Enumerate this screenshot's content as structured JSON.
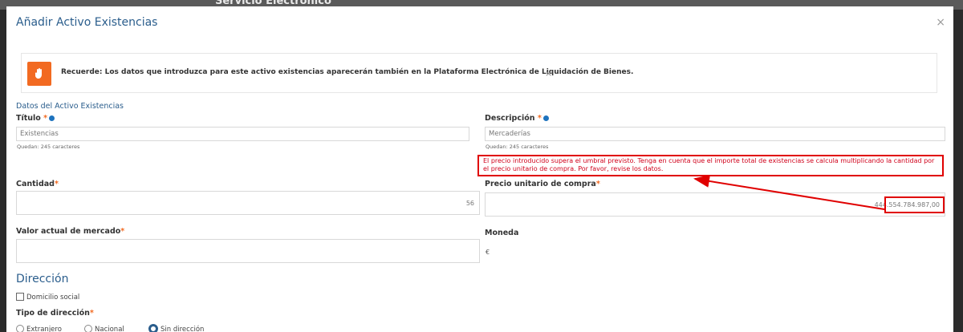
{
  "background": {
    "title": "Servicio Electrónico"
  },
  "modal": {
    "title": "Añadir Activo Existencias",
    "close_glyph": "×"
  },
  "notice": {
    "text": "Recuerde: Los datos que introduzca para este activo existencias aparecerán también en la Plataforma Electrónica de Liquidación de Bienes.",
    "dismiss_glyph": "×",
    "icon": "hand-icon",
    "accent": "#f26a21"
  },
  "section": {
    "label": "Datos del Activo Existencias"
  },
  "fields": {
    "titulo": {
      "label": "Título",
      "value": "Existencias",
      "hint": "Quedan: 245 caracteres"
    },
    "descripcion": {
      "label": "Descripción",
      "value": "Mercaderías",
      "hint": "Quedan: 245 caracteres"
    },
    "cantidad": {
      "label": "Cantidad",
      "value": "56"
    },
    "precio": {
      "label": "Precio unitario de compra",
      "value": "444.554.784.987,00"
    },
    "valor_mercado": {
      "label": "Valor actual de mercado",
      "value": ""
    },
    "moneda": {
      "label": "Moneda",
      "value": "€"
    }
  },
  "required_marker": "*",
  "error": {
    "text": "El precio introducido supera el umbral previsto. Tenga en cuenta que el importe total de existencias se calcula multiplicando la cantidad por el precio unitario de compra. Por favor, revise los datos.",
    "color": "#e00000"
  },
  "direccion": {
    "title": "Dirección",
    "domicilio_label": "Domicilio social",
    "tipo_label": "Tipo de dirección",
    "options": [
      "Extranjero",
      "Nacional",
      "Sin dirección"
    ],
    "selected": "Sin dirección"
  },
  "colors": {
    "primary": "#2a5d8c",
    "accent": "#f26a21",
    "error": "#e00000"
  }
}
